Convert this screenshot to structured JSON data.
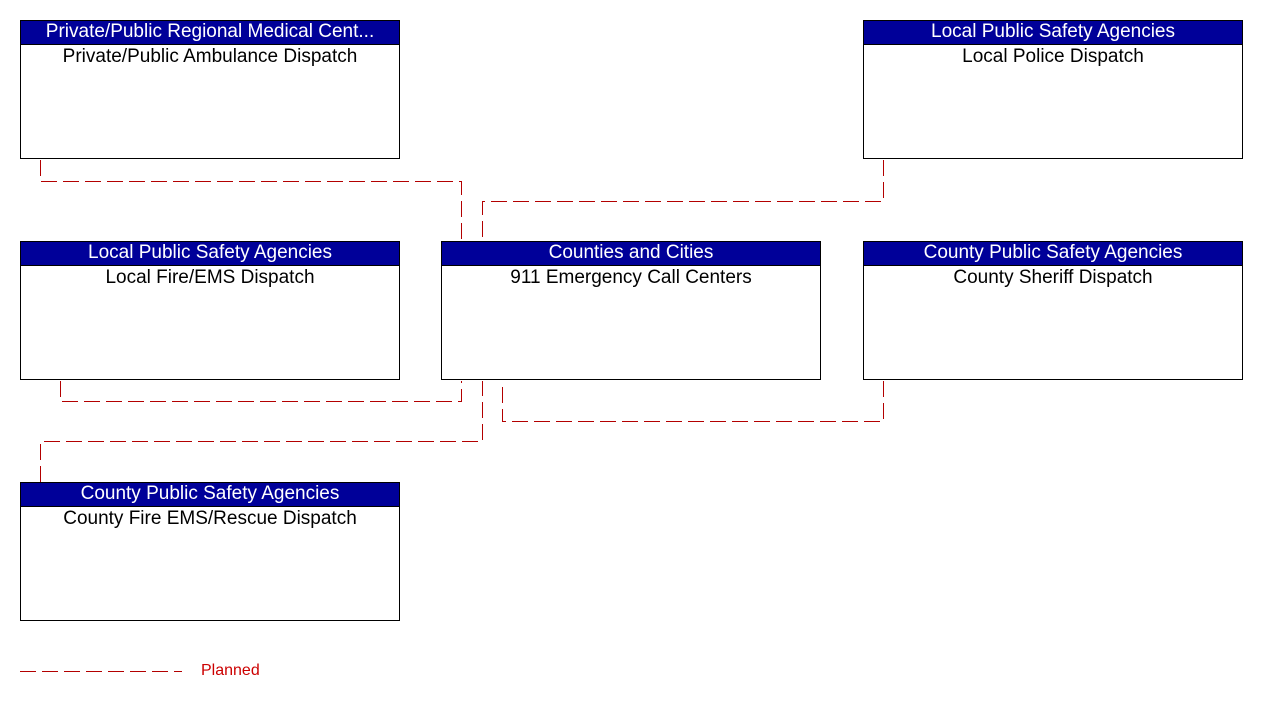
{
  "nodes": {
    "ambulance": {
      "stakeholder": "Private/Public Regional Medical Cent...",
      "element": "Private/Public Ambulance Dispatch"
    },
    "police": {
      "stakeholder": "Local Public Safety Agencies",
      "element": "Local Police Dispatch"
    },
    "fire": {
      "stakeholder": "Local Public Safety Agencies",
      "element": "Local Fire/EMS Dispatch"
    },
    "center": {
      "stakeholder": "Counties and Cities",
      "element": "911 Emergency Call Centers"
    },
    "sheriff": {
      "stakeholder": "County Public Safety Agencies",
      "element": "County Sheriff Dispatch"
    },
    "county_fire": {
      "stakeholder": "County Public Safety Agencies",
      "element": "County Fire EMS/Rescue Dispatch"
    }
  },
  "links": [
    {
      "from": "ambulance",
      "to": "center",
      "status": "Planned"
    },
    {
      "from": "police",
      "to": "center",
      "status": "Planned"
    },
    {
      "from": "fire",
      "to": "center",
      "status": "Planned"
    },
    {
      "from": "sheriff",
      "to": "center",
      "status": "Planned"
    },
    {
      "from": "county_fire",
      "to": "center",
      "status": "Planned"
    }
  ],
  "legend": {
    "planned_label": "Planned",
    "planned_color": "#b30000"
  }
}
